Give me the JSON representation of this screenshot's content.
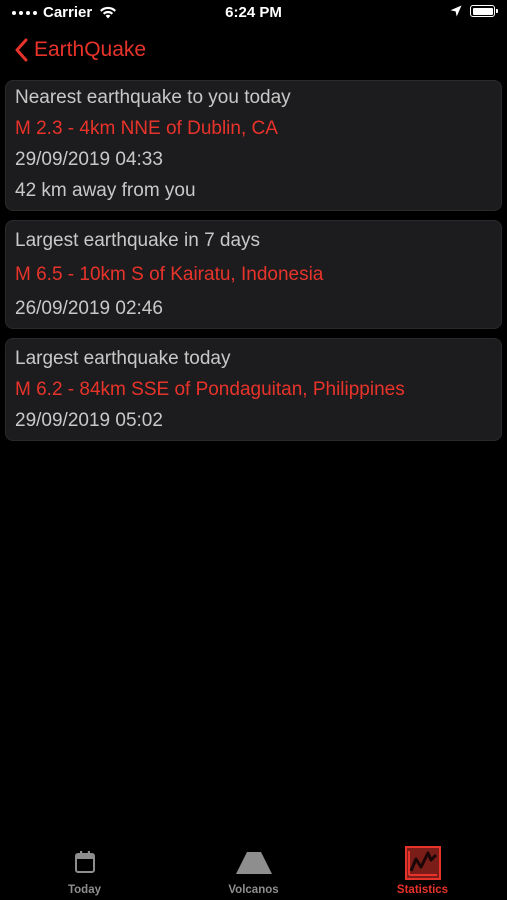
{
  "status_bar": {
    "carrier": "Carrier",
    "time": "6:24 PM"
  },
  "nav": {
    "back_label": "EarthQuake"
  },
  "cards": [
    {
      "title": "Nearest earthquake to you today",
      "quake": "M 2.3 - 4km NNE of Dublin, CA",
      "datetime": "29/09/2019 04:33",
      "distance": "42 km away from you"
    },
    {
      "title": "Largest earthquake in 7 days",
      "quake": "M 6.5 - 10km S of Kairatu, Indonesia",
      "datetime": "26/09/2019 02:46"
    },
    {
      "title": "Largest earthquake  today",
      "quake": "M 6.2 - 84km SSE of Pondaguitan, Philippines",
      "datetime": "29/09/2019 05:02"
    }
  ],
  "tabs": [
    {
      "label": "Today",
      "icon": "calendar-icon",
      "active": false
    },
    {
      "label": "Volcanos",
      "icon": "volcano-icon",
      "active": false
    },
    {
      "label": "Statistics",
      "icon": "chart-icon",
      "active": true
    }
  ],
  "colors": {
    "accent": "#e8332a",
    "background": "#000000",
    "card": "#1c1c1e",
    "secondary_text": "#c8c8c8",
    "inactive_tab": "#8e8e8e"
  }
}
